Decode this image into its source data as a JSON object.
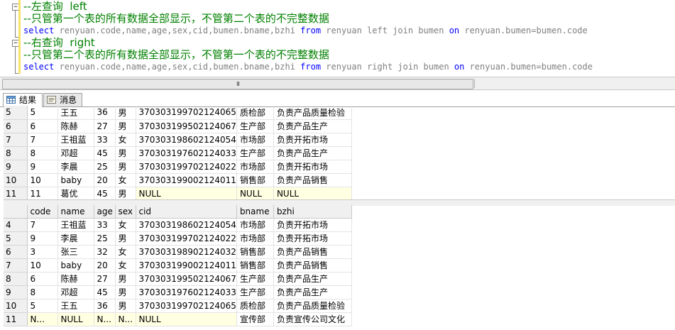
{
  "editor": {
    "block1": {
      "comment_title": "--左查询  left",
      "comment_desc": "--只管第一个表的所有数据全部显示，不管第二个表的不完整数据",
      "sql": {
        "kw_select": "select",
        "cols": " renyuan.code,name,age,sex,cid,bumen.bname,bzhi ",
        "kw_from": "from",
        "table1": " renyuan ",
        "join_type": "left join",
        "table2": " bumen ",
        "kw_on": "on",
        "cond": " renyuan.bumen=bumen.code"
      }
    },
    "block2": {
      "comment_title": "--右查询  right",
      "comment_desc": "--只管第二个表的所有数据全部显示，不管第一个表的不完整数据",
      "sql": {
        "kw_select": "select",
        "cols": " renyuan.code,name,age,sex,cid,bumen.bname,bzhi ",
        "kw_from": "from",
        "table1": " renyuan ",
        "join_type": "right join",
        "table2": " bumen ",
        "kw_on": "on",
        "cond": " renyuan.bumen=bumen.code"
      }
    },
    "collapse_glyph": "−"
  },
  "splitter": {
    "grip": "III"
  },
  "tabs": [
    {
      "label": "结果",
      "icon": "grid-icon"
    },
    {
      "label": "消息",
      "icon": "message-icon"
    }
  ],
  "grid1": {
    "rows": [
      [
        "5",
        "5",
        "王五",
        "36",
        "男",
        "370303199702124065",
        "质检部",
        "负责产品质量检验"
      ],
      [
        "6",
        "6",
        "陈赫",
        "27",
        "男",
        "370303199502124067",
        "生产部",
        "负责产品生产"
      ],
      [
        "7",
        "7",
        "王祖蓝",
        "33",
        "女",
        "370303198602124054",
        "市场部",
        "负责开拓市场"
      ],
      [
        "8",
        "8",
        "邓超",
        "45",
        "男",
        "370303197602124033",
        "生产部",
        "负责产品生产"
      ],
      [
        "9",
        "9",
        "李晨",
        "25",
        "男",
        "370303199702124022",
        "市场部",
        "负责开拓市场"
      ],
      [
        "10",
        "10",
        "baby",
        "20",
        "女",
        "370303199002124011",
        "销售部",
        "负责产品销售"
      ],
      [
        "11",
        "11",
        "葛优",
        "45",
        "男",
        "NULL",
        "NULL",
        "NULL"
      ]
    ]
  },
  "grid2": {
    "headers": [
      "",
      "code",
      "name",
      "age",
      "sex",
      "cid",
      "bname",
      "bzhi"
    ],
    "rows": [
      [
        "4",
        "7",
        "王祖蓝",
        "33",
        "女",
        "370303198602124054",
        "市场部",
        "负责开拓市场"
      ],
      [
        "5",
        "9",
        "李晨",
        "25",
        "男",
        "370303199702124022",
        "市场部",
        "负责开拓市场"
      ],
      [
        "6",
        "3",
        "张三",
        "32",
        "女",
        "370303198902124032",
        "销售部",
        "负责产品销售"
      ],
      [
        "7",
        "10",
        "baby",
        "20",
        "女",
        "370303199002124011",
        "销售部",
        "负责产品销售"
      ],
      [
        "8",
        "6",
        "陈赫",
        "27",
        "男",
        "370303199502124067",
        "生产部",
        "负责产品生产"
      ],
      [
        "9",
        "8",
        "邓超",
        "45",
        "男",
        "370303197602124033",
        "生产部",
        "负责产品生产"
      ],
      [
        "10",
        "5",
        "王五",
        "36",
        "男",
        "370303199702124065",
        "质检部",
        "负责产品质量检验"
      ],
      [
        "11",
        "N...",
        "NULL",
        "N...",
        "N...",
        "NULL",
        "宣传部",
        "负责宣传公司文化"
      ]
    ]
  },
  "colors": {
    "comment": "#008000",
    "keyword": "#0000ff",
    "identifier": "#808080",
    "null_cell": "#ffffe1",
    "header_bg": "#f0f0f0"
  }
}
